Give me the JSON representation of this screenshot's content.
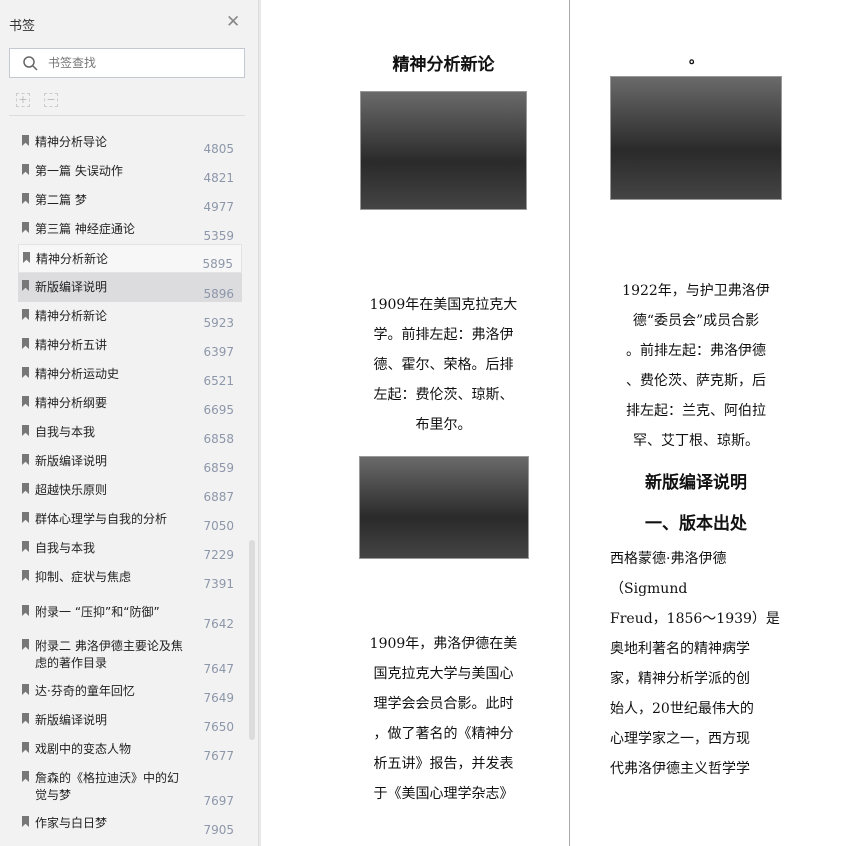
{
  "sidebar": {
    "title": "书签",
    "search_placeholder": "书签查找",
    "items": [
      {
        "label": "精神分析导论",
        "page": "4805"
      },
      {
        "label": "第一篇 失误动作",
        "page": "4821"
      },
      {
        "label": "第二篇 梦",
        "page": "4977"
      },
      {
        "label": "第三篇 神经症通论",
        "page": "5359"
      },
      {
        "label": "精神分析新论",
        "page": "5895"
      },
      {
        "label": "新版编译说明",
        "page": "5896"
      },
      {
        "label": "精神分析新论",
        "page": "5923"
      },
      {
        "label": "精神分析五讲",
        "page": "6397"
      },
      {
        "label": "精神分析运动史",
        "page": "6521"
      },
      {
        "label": "精神分析纲要",
        "page": "6695"
      },
      {
        "label": "自我与本我",
        "page": "6858"
      },
      {
        "label": "新版编译说明",
        "page": "6859"
      },
      {
        "label": "超越快乐原则",
        "page": "6887"
      },
      {
        "label": "群体心理学与自我的分析",
        "page": "7050"
      },
      {
        "label": "自我与本我",
        "page": "7229"
      },
      {
        "label": "抑制、症状与焦虑",
        "page": "7391"
      },
      {
        "label": "附录一 “压抑”和“防御”",
        "page": "7642"
      },
      {
        "label": "附录二 弗洛伊德主要论及焦虑的著作目录",
        "page": "7647"
      },
      {
        "label": "达·芬奇的童年回忆",
        "page": "7649"
      },
      {
        "label": "新版编译说明",
        "page": "7650"
      },
      {
        "label": "戏剧中的变态人物",
        "page": "7677"
      },
      {
        "label": "詹森的《格拉迪沃》中的幻觉与梦",
        "page": "7697"
      },
      {
        "label": "作家与白日梦",
        "page": "7905"
      }
    ]
  },
  "left_page": {
    "title": "精神分析新论",
    "caption1": [
      "1909年在美国克拉克大",
      "学。前排左起：弗洛伊",
      "德、霍尔、荣格。后排",
      "左起：费伦茨、琼斯、",
      "布里尔。"
    ],
    "caption2": [
      "1909年，弗洛伊德在美",
      "国克拉克大学与美国心",
      "理学会会员合影。此时",
      "，做了著名的《精神分",
      "析五讲》报告，并发表",
      "于《美国心理学杂志》"
    ]
  },
  "right_page": {
    "top_mark": "。",
    "caption": [
      "1922年，与护卫弗洛伊",
      "德“委员会”成员合影",
      "。前排左起：弗洛伊德",
      "、费伦茨、萨克斯，后",
      "排左起：兰克、阿伯拉",
      "罕、艾丁根、琼斯。"
    ],
    "heading1": "新版编译说明",
    "heading2": "一、版本出处",
    "body": [
      "西格蒙德·弗洛伊德",
      "（Sigmund",
      "Freud，1856～1939）是",
      "奥地利著名的精神病学",
      "家，精神分析学派的创",
      "始人，20世纪最伟大的",
      "心理学家之一，西方现",
      "代弗洛伊德主义哲学学"
    ]
  }
}
